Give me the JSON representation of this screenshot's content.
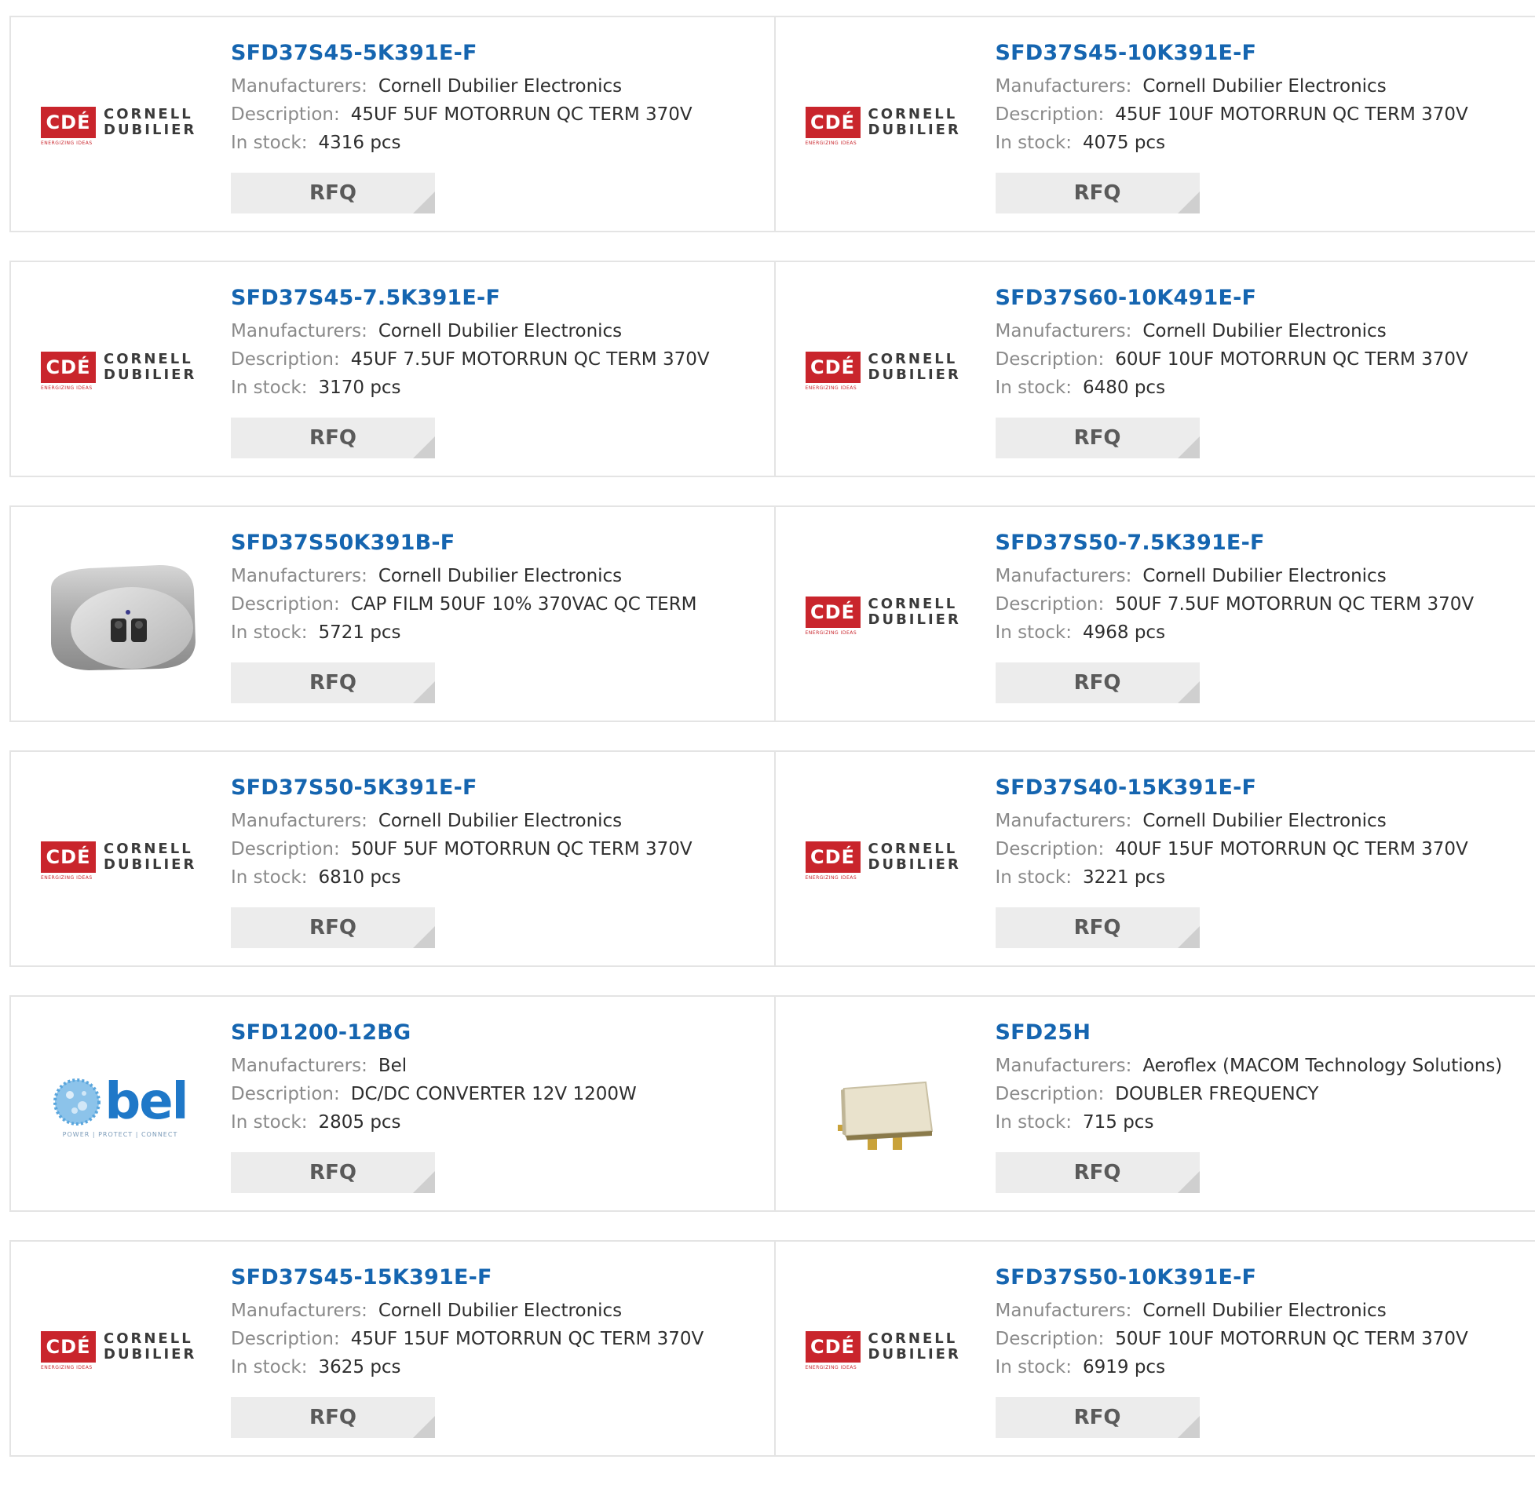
{
  "labels": {
    "manufacturers": "Manufacturers:",
    "description": "Description:",
    "in_stock": "In stock:",
    "rfq": "RFQ"
  },
  "logos": {
    "cde": {
      "mark": "CDÉ",
      "line1": "CORNELL",
      "line2": "DUBILIER",
      "tagline": "ENERGIZING IDEAS"
    },
    "bel": {
      "word": "bel",
      "tagline": "POWER | PROTECT | CONNECT"
    }
  },
  "colors": {
    "part_link": "#1565b0",
    "cde_red": "#c9252c",
    "bel_blue": "#1f78c8",
    "rfq_bg": "#ececec"
  },
  "products": [
    {
      "part": "SFD37S45-5K391E-F",
      "manufacturer": "Cornell Dubilier Electronics",
      "description": "45UF 5UF MOTORRUN QC TERM 370V",
      "stock": "4316 pcs",
      "image": "cde-logo"
    },
    {
      "part": "SFD37S45-10K391E-F",
      "manufacturer": "Cornell Dubilier Electronics",
      "description": "45UF 10UF MOTORRUN QC TERM 370V",
      "stock": "4075 pcs",
      "image": "cde-logo"
    },
    {
      "part": "SFD37S45-7.5K391E-F",
      "manufacturer": "Cornell Dubilier Electronics",
      "description": "45UF 7.5UF MOTORRUN QC TERM 370V",
      "stock": "3170 pcs",
      "image": "cde-logo"
    },
    {
      "part": "SFD37S60-10K491E-F",
      "manufacturer": "Cornell Dubilier Electronics",
      "description": "60UF 10UF MOTORRUN QC TERM 370V",
      "stock": "6480 pcs",
      "image": "cde-logo"
    },
    {
      "part": "SFD37S50K391B-F",
      "manufacturer": "Cornell Dubilier Electronics",
      "description": "CAP FILM 50UF 10% 370VAC QC TERM",
      "stock": "5721 pcs",
      "image": "capacitor-photo"
    },
    {
      "part": "SFD37S50-7.5K391E-F",
      "manufacturer": "Cornell Dubilier Electronics",
      "description": "50UF 7.5UF MOTORRUN QC TERM 370V",
      "stock": "4968 pcs",
      "image": "cde-logo"
    },
    {
      "part": "SFD37S50-5K391E-F",
      "manufacturer": "Cornell Dubilier Electronics",
      "description": "50UF 5UF MOTORRUN QC TERM 370V",
      "stock": "6810 pcs",
      "image": "cde-logo"
    },
    {
      "part": "SFD37S40-15K391E-F",
      "manufacturer": "Cornell Dubilier Electronics",
      "description": "40UF 15UF MOTORRUN QC TERM 370V",
      "stock": "3221 pcs",
      "image": "cde-logo"
    },
    {
      "part": "SFD1200-12BG",
      "manufacturer": "Bel",
      "description": "DC/DC CONVERTER 12V 1200W",
      "stock": "2805 pcs",
      "image": "bel-logo"
    },
    {
      "part": "SFD25H",
      "manufacturer": "Aeroflex (MACOM Technology Solutions)",
      "description": "DOUBLER FREQUENCY",
      "stock": "715 pcs",
      "image": "module-photo"
    },
    {
      "part": "SFD37S45-15K391E-F",
      "manufacturer": "Cornell Dubilier Electronics",
      "description": "45UF 15UF MOTORRUN QC TERM 370V",
      "stock": "3625 pcs",
      "image": "cde-logo"
    },
    {
      "part": "SFD37S50-10K391E-F",
      "manufacturer": "Cornell Dubilier Electronics",
      "description": "50UF 10UF MOTORRUN QC TERM 370V",
      "stock": "6919 pcs",
      "image": "cde-logo"
    }
  ]
}
